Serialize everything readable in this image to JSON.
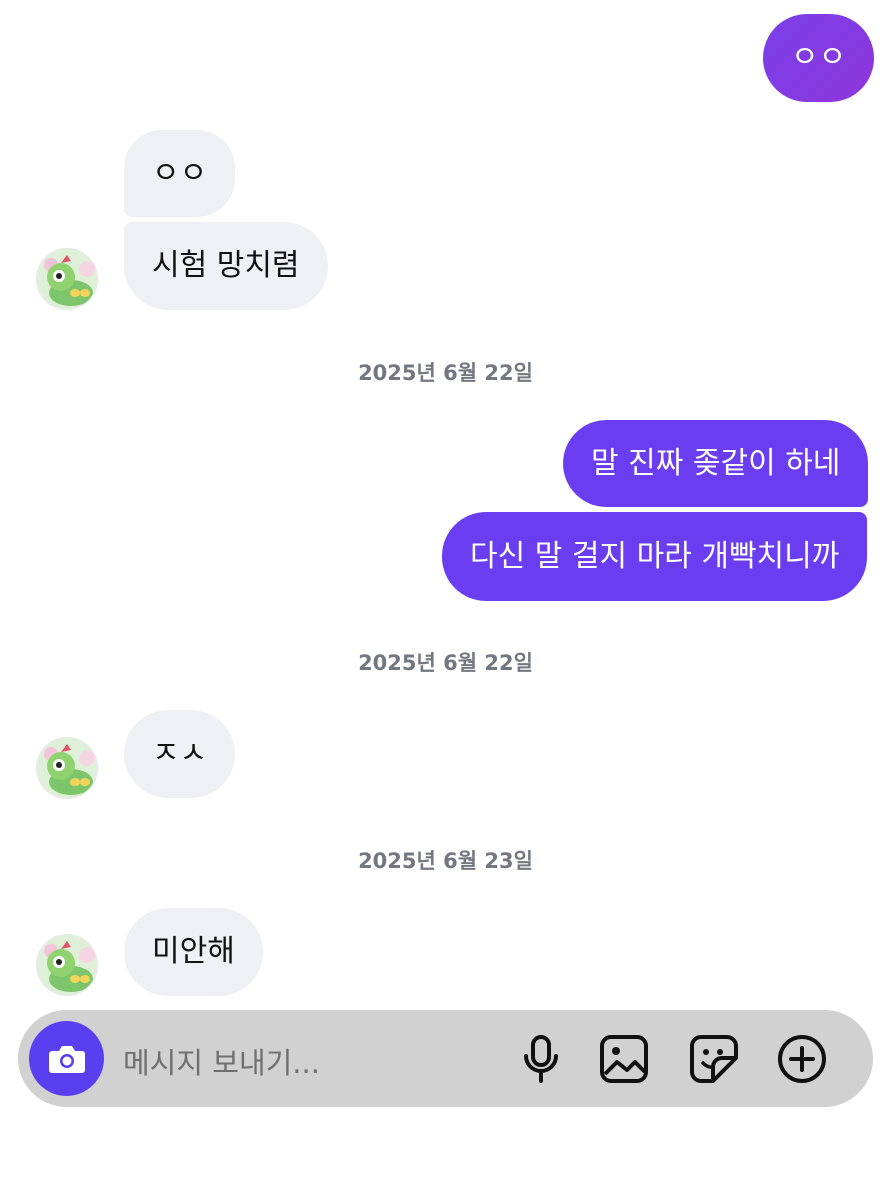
{
  "colors": {
    "outgoing_bubble": "#6a3ef0",
    "outgoing_gradient_end": "#7b35e0",
    "incoming_bubble": "#eff0f4",
    "camera_button": "#5a3ff0",
    "composer_bg": "#d1d1d1",
    "timestamp_text": "#737880"
  },
  "messages": [
    {
      "direction": "outgoing",
      "text": "ㅇㅇ"
    },
    {
      "direction": "incoming",
      "text": "ㅇㅇ"
    },
    {
      "direction": "incoming",
      "text": "시험 망치렴"
    },
    {
      "direction": "timestamp",
      "text": "2025년 6월 22일"
    },
    {
      "direction": "outgoing",
      "text": "말 진짜 좆같이 하네"
    },
    {
      "direction": "outgoing",
      "text": "다신 말 걸지 마라 개빡치니까"
    },
    {
      "direction": "timestamp",
      "text": "2025년 6월 22일"
    },
    {
      "direction": "incoming",
      "text": "ㅈㅅ"
    },
    {
      "direction": "timestamp",
      "text": "2025년 6월 23일"
    },
    {
      "direction": "incoming",
      "text": "미안해"
    }
  ],
  "composer": {
    "camera_icon": "camera-icon",
    "placeholder": "메시지 보내기...",
    "tools": [
      "microphone-icon",
      "image-icon",
      "sticker-icon",
      "plus-circle-icon"
    ]
  }
}
